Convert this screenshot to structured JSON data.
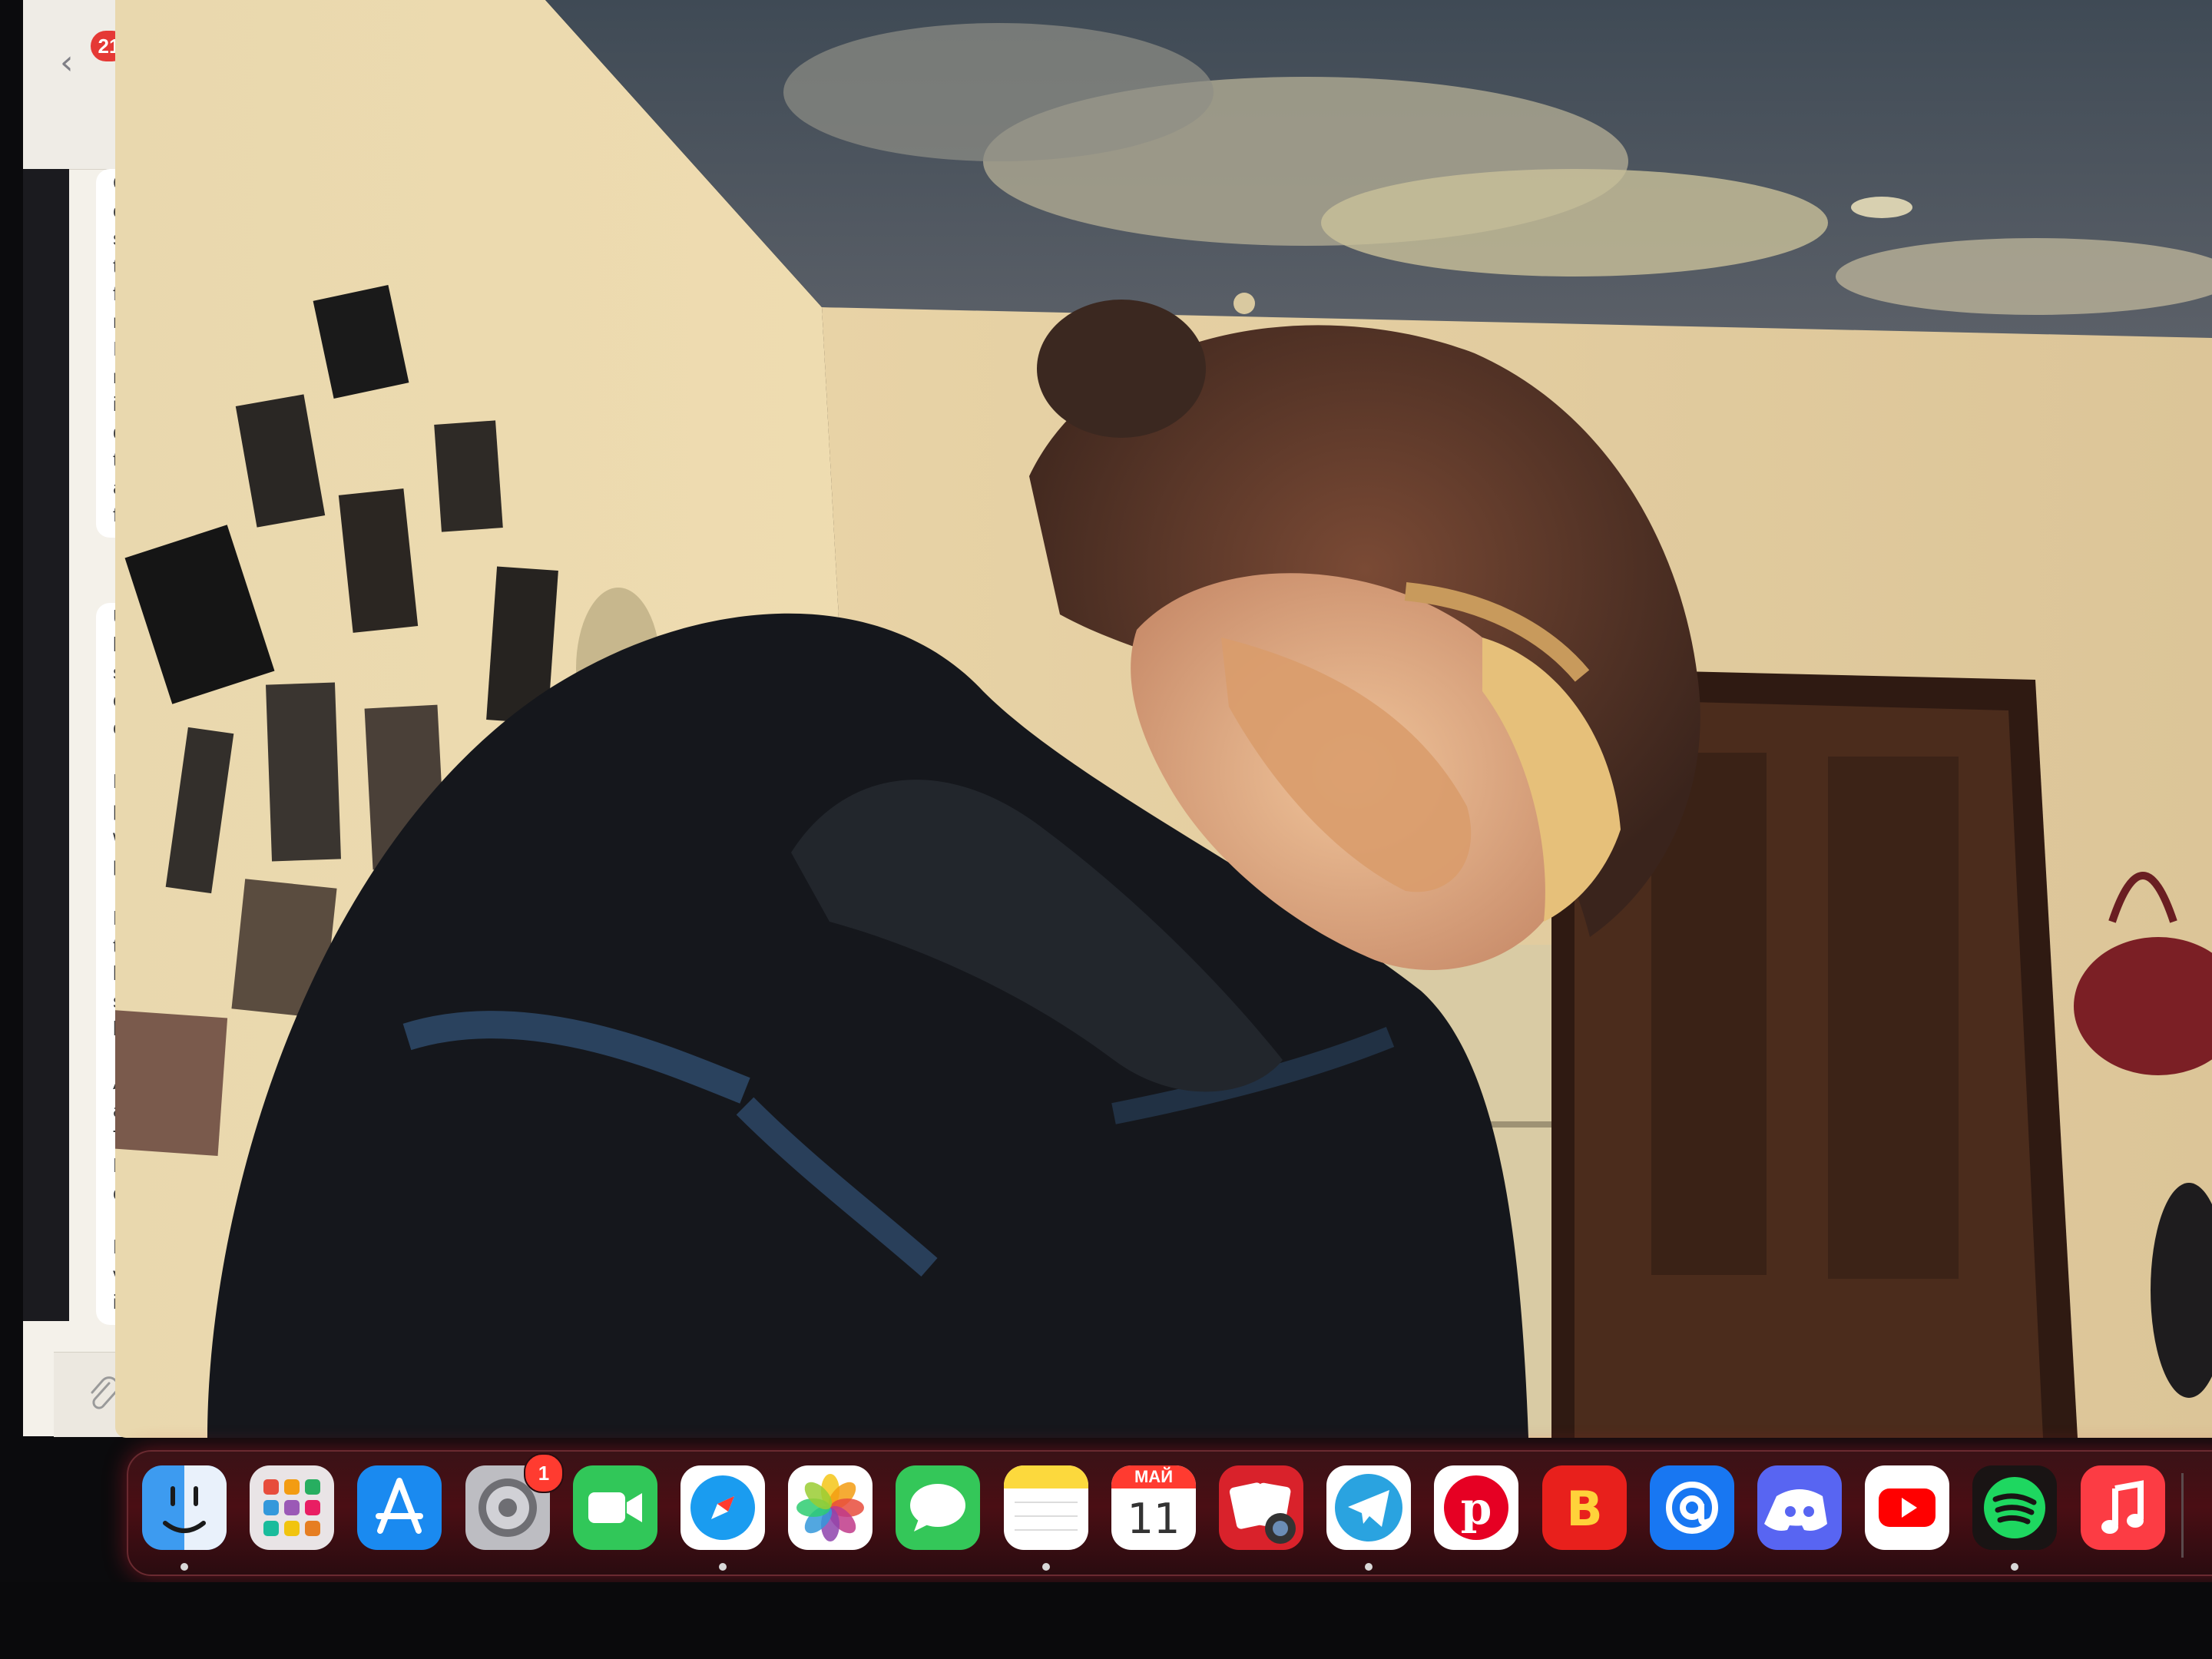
{
  "messages_window": {
    "unread_count": "21",
    "back_glyph": "‹",
    "bubble1_lines": [
      "Or",
      "ov",
      "sh",
      "to",
      "fa",
      "m",
      "In",
      "ro",
      "in",
      "dr",
      "to",
      "ar",
      "fo"
    ],
    "bubble2_lines": [
      "Ur",
      "lea",
      "sig",
      "cl",
      "cl",
      "",
      "No",
      "po",
      "wo",
      "pl",
      "",
      "Liv",
      "th",
      "liv",
      "su",
      "lov",
      "",
      "Al",
      "an",
      "Th",
      "Ro",
      "of",
      "",
      "Fi",
      "ve",
      "in"
    ],
    "attach_icon": "paperclip-icon"
  },
  "video": {
    "description_icon": "camera-feed"
  },
  "dock": {
    "apps": [
      {
        "id": "finder",
        "icon": "finder-icon",
        "running": true
      },
      {
        "id": "launchpad",
        "icon": "launchpad-icon",
        "running": false
      },
      {
        "id": "app-store",
        "icon": "app-store-icon",
        "running": false
      },
      {
        "id": "system-settings",
        "icon": "gear-icon",
        "running": false,
        "badge": "1"
      },
      {
        "id": "facetime",
        "icon": "facetime-icon",
        "running": false
      },
      {
        "id": "safari",
        "icon": "safari-icon",
        "running": true
      },
      {
        "id": "photos",
        "icon": "photos-icon",
        "running": false
      },
      {
        "id": "messages",
        "icon": "messages-icon",
        "running": false
      },
      {
        "id": "notes",
        "icon": "notes-icon",
        "running": true
      },
      {
        "id": "calendar",
        "icon": "calendar-icon",
        "running": false,
        "month": "МАЙ",
        "day": "11"
      },
      {
        "id": "photo-booth",
        "icon": "photo-booth-icon",
        "running": false
      },
      {
        "id": "telegram",
        "icon": "telegram-icon",
        "running": true
      },
      {
        "id": "pinterest",
        "icon": "pinterest-icon",
        "running": false
      },
      {
        "id": "vk",
        "icon": "vk-icon",
        "running": false,
        "label": "B"
      },
      {
        "id": "mail",
        "icon": "mail-at-icon",
        "running": false
      },
      {
        "id": "discord",
        "icon": "discord-icon",
        "running": false
      },
      {
        "id": "youtube",
        "icon": "youtube-icon",
        "running": false
      },
      {
        "id": "spotify",
        "icon": "spotify-icon",
        "running": true
      },
      {
        "id": "music",
        "icon": "music-icon",
        "running": false
      }
    ],
    "colors": {
      "finder": "#3d9bf0",
      "launchpad": "#e9e4e6",
      "app-store": "#1a8af0",
      "settings": "#8e8e93",
      "facetime": "#31c759",
      "safari": "#ffffff",
      "photos": "#ffffff",
      "messages": "#34c759",
      "notes": "#fcd93d",
      "calendar": "#ffffff",
      "photo-booth": "#d9222b",
      "telegram": "#ffffff",
      "pinterest": "#ffffff",
      "vk": "#e8201c",
      "mail": "#1877f2",
      "discord": "#5865f2",
      "youtube": "#ffffff",
      "spotify": "#191414",
      "music": "#fc3c44"
    }
  }
}
